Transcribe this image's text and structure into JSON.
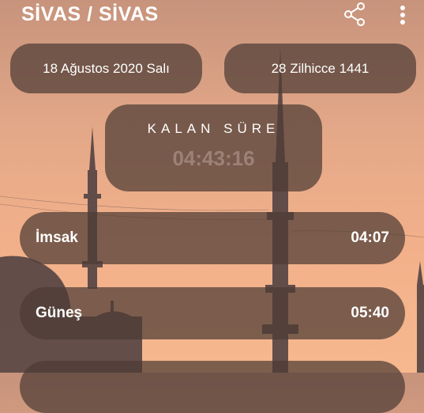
{
  "header": {
    "title": "SİVAS / SİVAS",
    "share_icon": "share-icon",
    "more_icon": "more-vertical-icon"
  },
  "dates": {
    "gregorian": "18 Ağustos 2020 Salı",
    "hijri": "28 Zilhicce 1441"
  },
  "remaining": {
    "label": "KALAN SÜRE",
    "time": "04:43:16"
  },
  "prayers": [
    {
      "name": "İmsak",
      "time": "04:07"
    },
    {
      "name": "Güneş",
      "time": "05:40"
    },
    {
      "name": "",
      "time": ""
    }
  ],
  "colors": {
    "pill_bg": "#4e3c34",
    "sky_top": "#c7937c",
    "sky_bottom": "#f7b88e"
  }
}
